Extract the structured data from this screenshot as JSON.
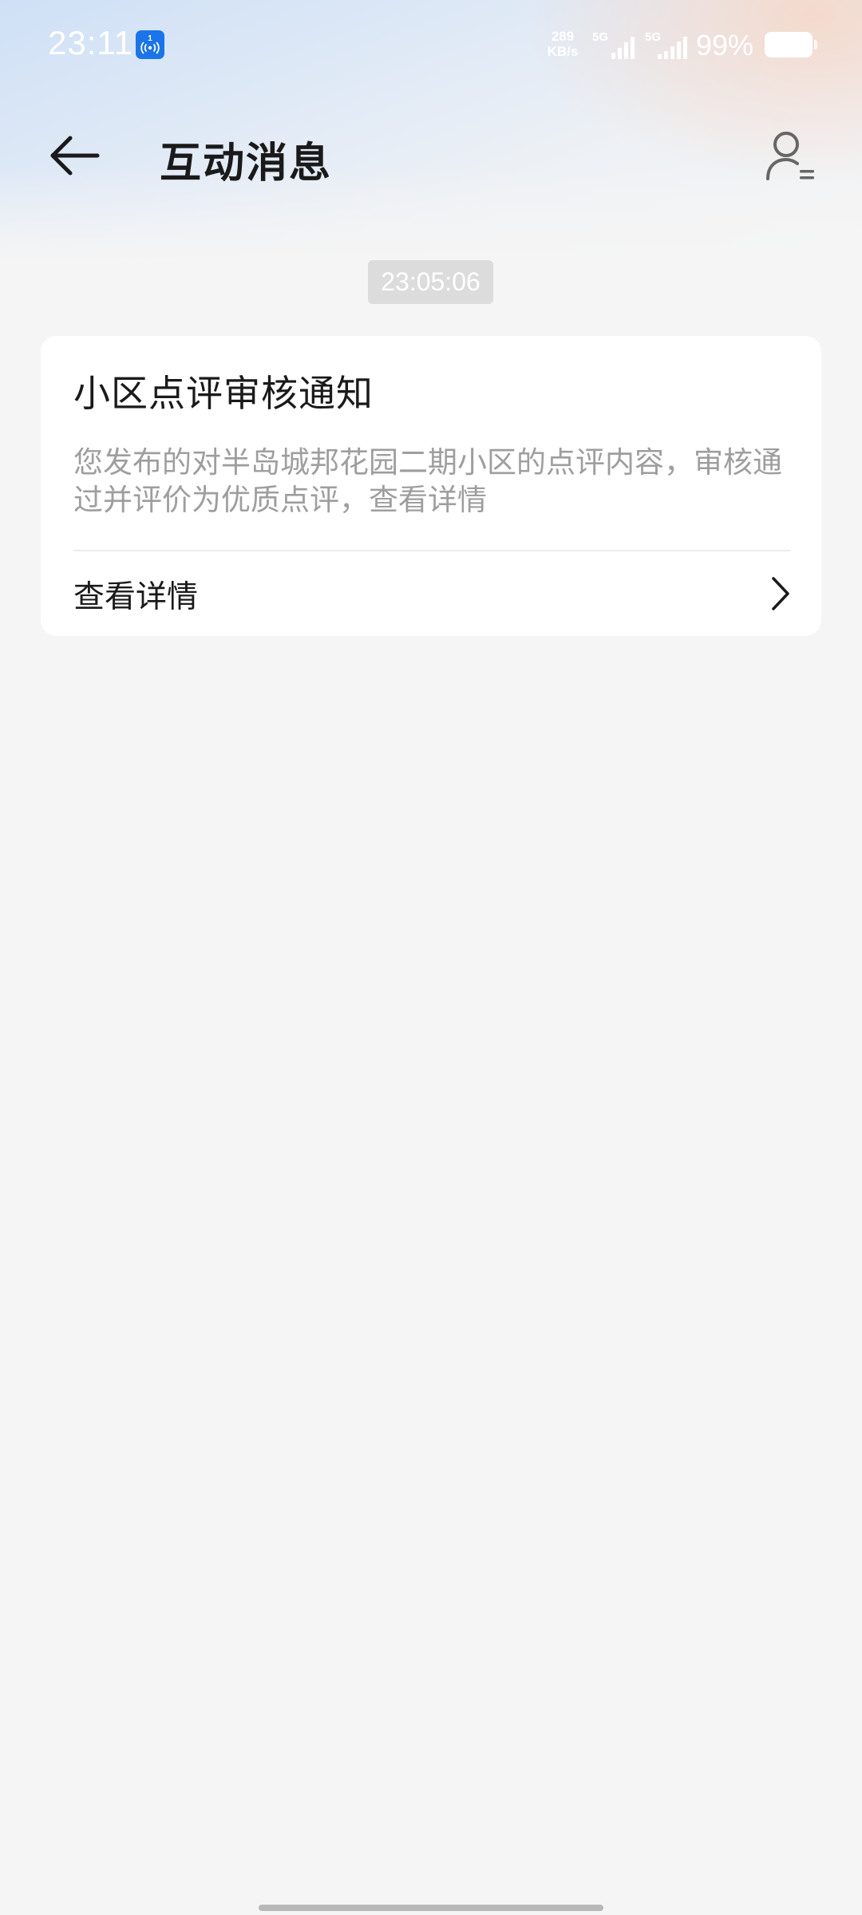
{
  "status_bar": {
    "time": "23:11",
    "net_speed_value": "289",
    "net_speed_unit": "KB/s",
    "sim1_label": "5G",
    "sim2_label": "5G",
    "battery": "99%"
  },
  "header": {
    "title": "互动消息"
  },
  "messages": [
    {
      "timestamp": "23:05:06",
      "title": "小区点评审核通知",
      "body": "您发布的对半岛城邦花园二期小区的点评内容，审核通过并评价为优质点评，查看详情",
      "action_label": "查看详情"
    }
  ],
  "icons": {
    "back": "arrow-left-icon",
    "contact": "user-settings-icon",
    "chevron": "chevron-right-icon",
    "hotspot": "hotspot-icon"
  },
  "colors": {
    "background": "#f5f5f5",
    "card": "#ffffff",
    "title_text": "#1a1a1a",
    "secondary_text": "#9e9e9e",
    "timestamp_bg": "#dcdcdc",
    "hotspot_blue": "#1b74e8"
  }
}
